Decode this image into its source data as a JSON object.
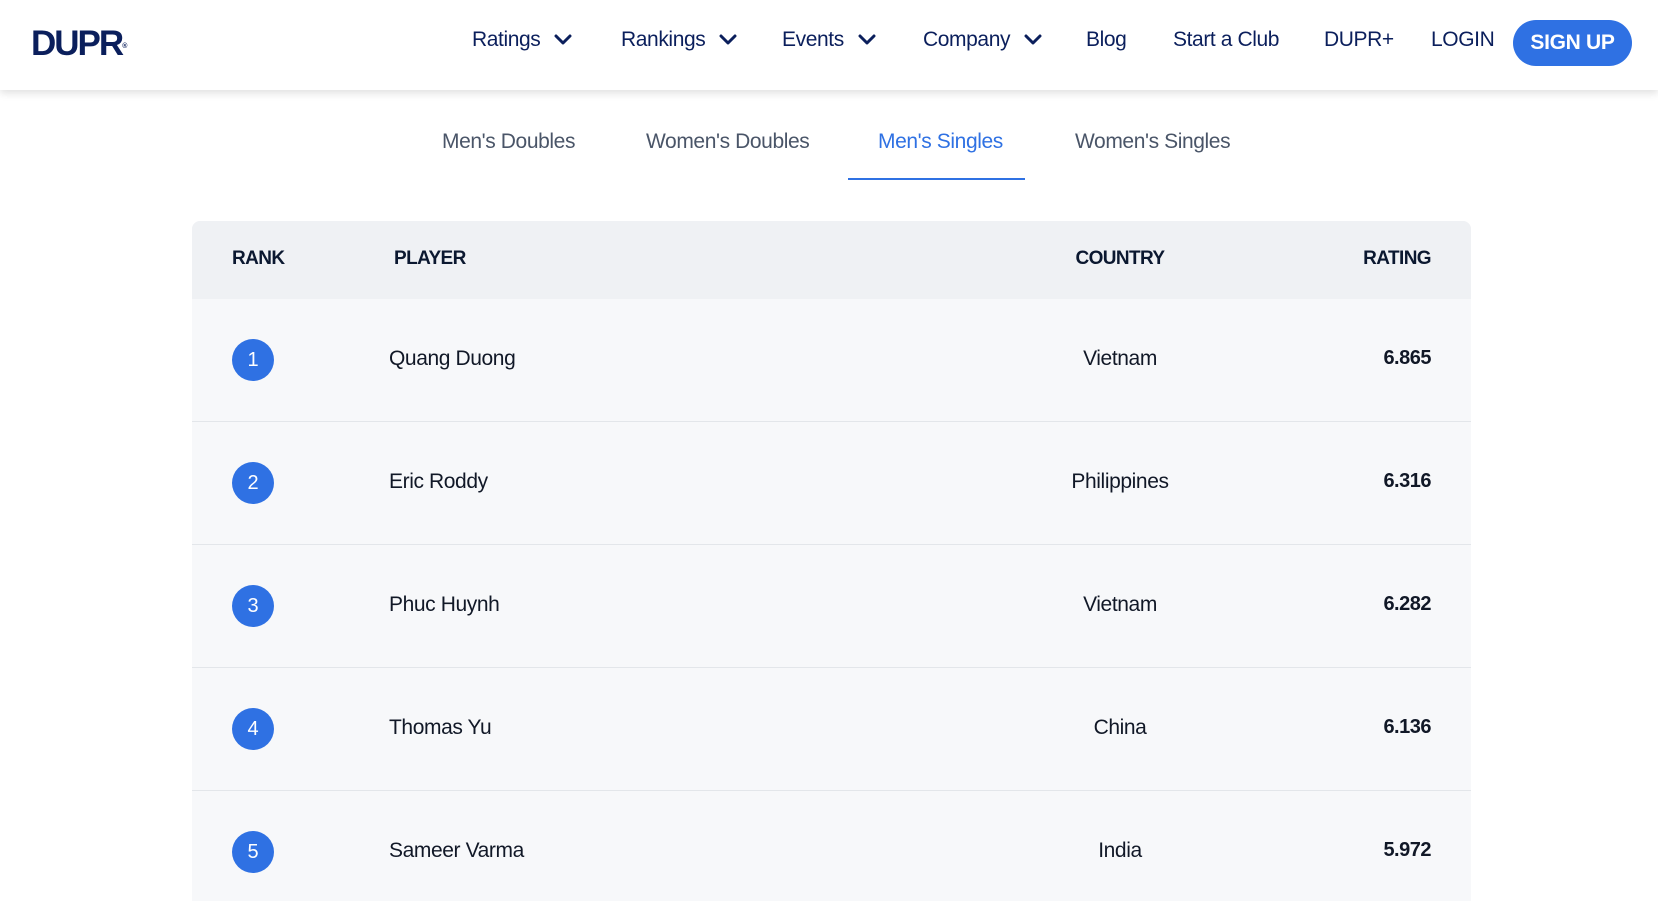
{
  "header": {
    "logo": "DUPR",
    "logo_mark": "®",
    "nav": [
      {
        "label": "Ratings",
        "dropdown": true
      },
      {
        "label": "Rankings",
        "dropdown": true
      },
      {
        "label": "Events",
        "dropdown": true
      },
      {
        "label": "Company",
        "dropdown": true
      },
      {
        "label": "Blog",
        "dropdown": false
      },
      {
        "label": "Start a Club",
        "dropdown": false
      },
      {
        "label": "DUPR+",
        "dropdown": false
      },
      {
        "label": "LOGIN",
        "dropdown": false
      }
    ],
    "signup_label": "SIGN UP"
  },
  "tabs": {
    "items": [
      "Men's Doubles",
      "Women's Doubles",
      "Men's Singles",
      "Women's Singles"
    ],
    "active": "Men's Singles"
  },
  "table": {
    "columns": {
      "rank": "RANK",
      "player": "PLAYER",
      "country": "COUNTRY",
      "rating": "RATING"
    },
    "rows": [
      {
        "rank": "1",
        "player": "Quang Duong",
        "country": "Vietnam",
        "rating": "6.865"
      },
      {
        "rank": "2",
        "player": "Eric Roddy",
        "country": "Philippines",
        "rating": "6.316"
      },
      {
        "rank": "3",
        "player": "Phuc Huynh",
        "country": "Vietnam",
        "rating": "6.282"
      },
      {
        "rank": "4",
        "player": "Thomas Yu",
        "country": "China",
        "rating": "6.136"
      },
      {
        "rank": "5",
        "player": "Sameer Varma",
        "country": "India",
        "rating": "5.972"
      }
    ]
  },
  "colors": {
    "brand_navy": "#0b1f5c",
    "accent_blue": "#2f71e3",
    "tab_text": "#4a5568",
    "table_bg": "#f7f8fa",
    "header_bg": "#eff1f4"
  },
  "icons": {
    "dropdown": "chevron-down-icon"
  }
}
